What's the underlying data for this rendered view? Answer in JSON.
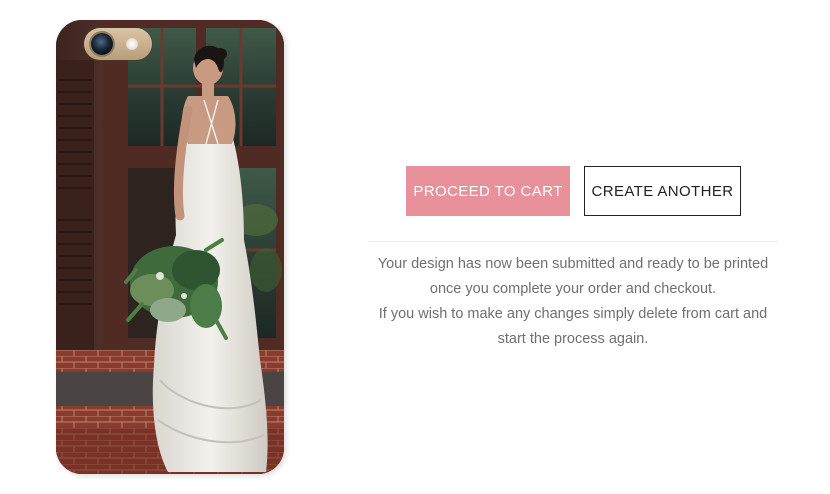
{
  "product_preview": {
    "image_alt": "Custom phone case with bride photo",
    "icon_camera": "camera-lens-icon",
    "icon_flash": "camera-flash-icon"
  },
  "actions": {
    "proceed_label": "PROCEED TO CART",
    "create_label": "CREATE ANOTHER"
  },
  "message": {
    "line1": "Your design has now been submitted and ready to be printed",
    "line2": "once you complete your order and checkout.",
    "line3": "If you wish to make any changes simply delete from cart and",
    "line4": "start the process again."
  },
  "colors": {
    "accent": "#e8919b",
    "text_muted": "#6f6f6f",
    "border_dark": "#222222"
  }
}
